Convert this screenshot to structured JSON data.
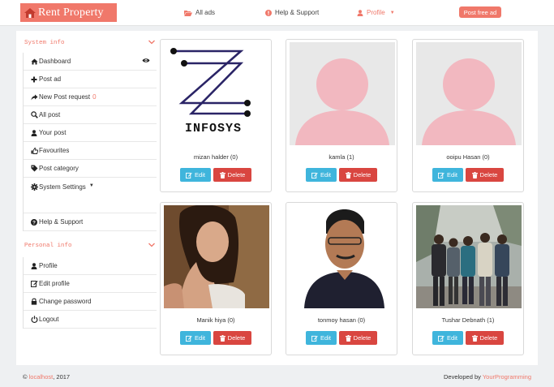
{
  "header": {
    "brand": "Rent Property",
    "nav": {
      "all_ads": "All ads",
      "help": "Help & Support",
      "profile": "Profile",
      "post_free": "Post free ad"
    }
  },
  "sidebar": {
    "system_title": "System info",
    "system_items": [
      {
        "label": "Dashboard",
        "icon": "home-icon"
      },
      {
        "label": "Post ad",
        "icon": "plus-icon"
      },
      {
        "label": "New Post request",
        "icon": "share-icon",
        "count": "0"
      },
      {
        "label": "All post",
        "icon": "zoom-icon"
      },
      {
        "label": "Your post",
        "icon": "user-icon"
      },
      {
        "label": "Favourites",
        "icon": "thumbs-up-icon"
      },
      {
        "label": "Post category",
        "icon": "tag-icon"
      },
      {
        "label": "System Settings",
        "icon": "cog-icon"
      },
      {
        "label": "Help & Support",
        "icon": "question-icon"
      }
    ],
    "personal_title": "Personal info",
    "personal_items": [
      {
        "label": "Profile",
        "icon": "user-icon"
      },
      {
        "label": "Edit profile",
        "icon": "edit-icon"
      },
      {
        "label": "Change password",
        "icon": "lock-icon"
      },
      {
        "label": "Logout",
        "icon": "power-icon"
      }
    ]
  },
  "users": [
    {
      "name": "mizan halder (0)",
      "image": "infosys-logo"
    },
    {
      "name": "kamla (1)",
      "image": "avatar-placeholder"
    },
    {
      "name": "ooipu Hasan (0)",
      "image": "avatar-placeholder"
    },
    {
      "name": "Manik hiya (0)",
      "image": "portrait-photo"
    },
    {
      "name": "tonmoy hasan (0)",
      "image": "portrait-photo"
    },
    {
      "name": "Tushar Debnath (1)",
      "image": "group-photo"
    }
  ],
  "logo_text": "INFOSYS",
  "actions": {
    "edit": "Edit",
    "delete": "Delete"
  },
  "footer": {
    "copyright_prefix": "©",
    "host": "localhost",
    "year": ", 2017",
    "developed_by": "Developed by",
    "developer": "YourProgramming"
  },
  "colors": {
    "accent": "#f0786a",
    "edit": "#3fb5dc",
    "delete": "#d94640"
  }
}
